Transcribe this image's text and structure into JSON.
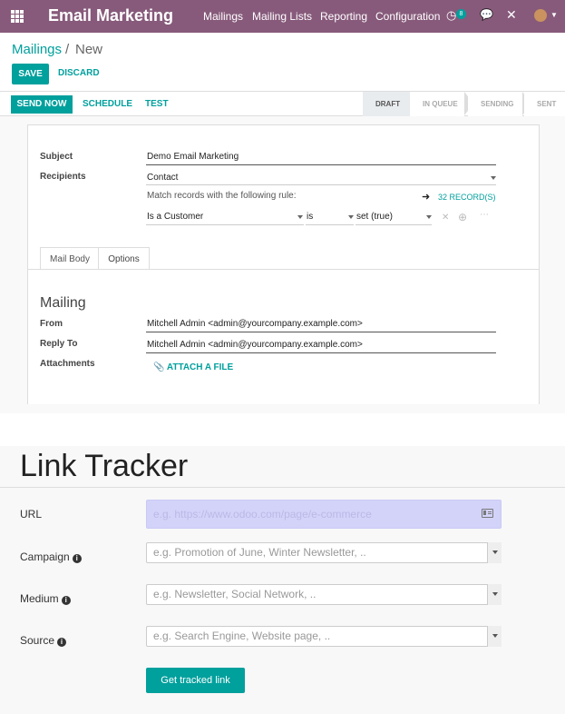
{
  "topnav": {
    "brand": "Email Marketing",
    "menu": [
      "Mailings",
      "Mailing Lists",
      "Reporting",
      "Configuration"
    ],
    "activity_count": "8",
    "icons": [
      "apps-grid-icon",
      "clock-icon",
      "chat-icon",
      "close-icon",
      "avatar",
      "chevron-down-icon"
    ]
  },
  "breadcrumb": {
    "parent": "Mailings",
    "separator": "/",
    "current": "New"
  },
  "buttons": {
    "save": "SAVE",
    "discard": "DISCARD"
  },
  "statusbar": {
    "actions": [
      "SEND NOW",
      "SCHEDULE",
      "TEST"
    ],
    "stages": [
      "DRAFT",
      "IN QUEUE",
      "SENDING",
      "SENT"
    ],
    "active_stage": "DRAFT"
  },
  "form": {
    "subject_label": "Subject",
    "subject_value": "Demo Email Marketing",
    "recipients_label": "Recipients",
    "recipients_value": "Contact",
    "rule_text": "Match records with the following rule:",
    "records_link": "32 RECORD(S)",
    "rule_field": "Is a Customer",
    "rule_operator": "is",
    "rule_value": "set (true)"
  },
  "tabs": [
    "Mail Body",
    "Options"
  ],
  "active_tab": "Options",
  "mailing": {
    "title": "Mailing",
    "from_label": "From",
    "from_value": "Mitchell Admin <admin@yourcompany.example.com>",
    "reply_label": "Reply To",
    "reply_value": "Mitchell Admin <admin@yourcompany.example.com>",
    "attachments_label": "Attachments",
    "attach_button": "ATTACH A FILE"
  },
  "link_tracker": {
    "title": "Link Tracker",
    "url_label": "URL",
    "url_placeholder": "e.g. https://www.odoo.com/page/e-commerce",
    "campaign_label": "Campaign",
    "campaign_placeholder": "e.g. Promotion of June, Winter Newsletter, ..",
    "medium_label": "Medium",
    "medium_placeholder": "e.g. Newsletter, Social Network, ..",
    "source_label": "Source",
    "source_placeholder": "e.g. Search Engine, Website page, ..",
    "submit": "Get tracked link"
  },
  "colors": {
    "brand": "#875a7b",
    "accent": "#00a09d"
  }
}
